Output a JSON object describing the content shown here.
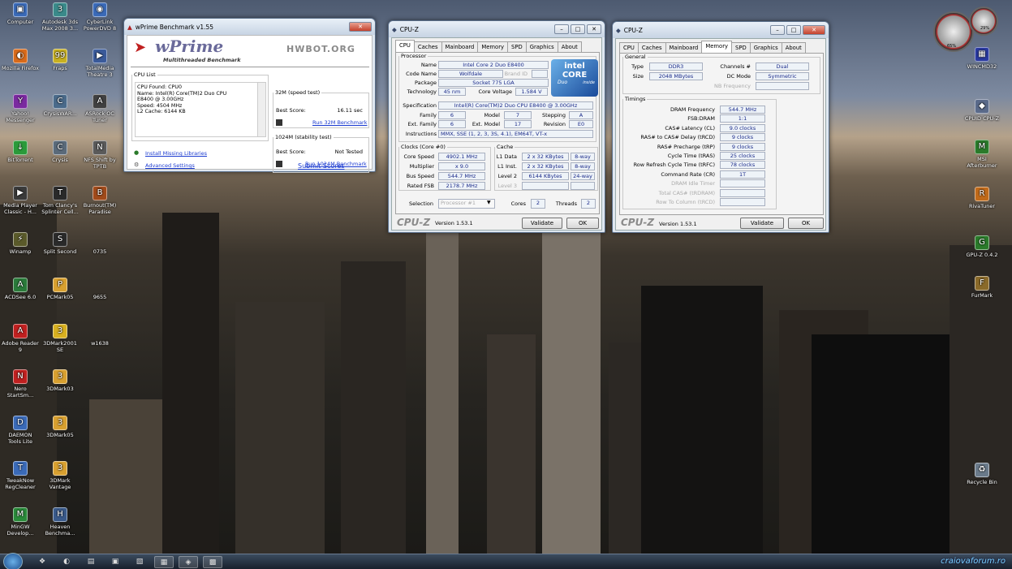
{
  "desktop_icons": [
    {
      "label": "Computer",
      "glyph": "▣",
      "color": "#3a6ab8"
    },
    {
      "label": "Autodesk 3ds Max 2008 3...",
      "glyph": "3",
      "color": "#3a8a8a"
    },
    {
      "label": "CyberLink PowerDVD 8",
      "glyph": "◉",
      "color": "#3a6ab8"
    },
    {
      "label": "Mozilla Firefox",
      "glyph": "◐",
      "color": "#d86a1a"
    },
    {
      "label": "Fraps",
      "glyph": "99",
      "color": "#c8b020"
    },
    {
      "label": "TotalMedia Theatre 3",
      "glyph": "▶",
      "color": "#3a5a9a"
    },
    {
      "label": "Yahoo! Messenger",
      "glyph": "Y",
      "color": "#7a2aa0"
    },
    {
      "label": "CrysisWAR...",
      "glyph": "C",
      "color": "#4a6a8a"
    },
    {
      "label": "ASRock OC Tuner",
      "glyph": "A",
      "color": "#404040"
    },
    {
      "label": "BitTorrent",
      "glyph": "↓",
      "color": "#2a9a3a"
    },
    {
      "label": "Crysis",
      "glyph": "C",
      "color": "#5a6a7a"
    },
    {
      "label": "NFS Shift by TPTB",
      "glyph": "N",
      "color": "#5a5a5a"
    },
    {
      "label": "Media Player Classic - H...",
      "glyph": "▶",
      "color": "#3a3a3a"
    },
    {
      "label": "Tom Clancy's Splinter Cell...",
      "glyph": "T",
      "color": "#2a2a2a"
    },
    {
      "label": "Burnout(TM) Paradise",
      "glyph": "B",
      "color": "#a04a1a"
    },
    {
      "label": "Winamp",
      "glyph": "⚡",
      "color": "#5a5a2a"
    },
    {
      "label": "Split Second",
      "glyph": "S",
      "color": "#2a2a2a"
    },
    {
      "label": "0735",
      "glyph": "",
      "color": "transparent"
    },
    {
      "label": "ACDSee 6.0",
      "glyph": "A",
      "color": "#2a7a3a"
    },
    {
      "label": "PCMark05",
      "glyph": "P",
      "color": "#d8a030"
    },
    {
      "label": "9655",
      "glyph": "",
      "color": "transparent"
    },
    {
      "label": "Adobe Reader 9",
      "glyph": "A",
      "color": "#c02020"
    },
    {
      "label": "3DMark2001 SE",
      "glyph": "3",
      "color": "#d8b020"
    },
    {
      "label": "w1638",
      "glyph": "",
      "color": "transparent"
    },
    {
      "label": "Nero StartSm...",
      "glyph": "N",
      "color": "#c02020"
    },
    {
      "label": "3DMark03",
      "glyph": "3",
      "color": "#d8a030"
    },
    {
      "label": "",
      "glyph": "",
      "color": "transparent"
    },
    {
      "label": "DAEMON Tools Lite",
      "glyph": "D",
      "color": "#3a6ab8"
    },
    {
      "label": "3DMark05",
      "glyph": "3",
      "color": "#d8a030"
    },
    {
      "label": "",
      "glyph": "",
      "color": "transparent"
    },
    {
      "label": "TweakNow RegCleaner",
      "glyph": "T",
      "color": "#3a6ab8"
    },
    {
      "label": "3DMark Vantage",
      "glyph": "3",
      "color": "#d8a030"
    },
    {
      "label": "",
      "glyph": "",
      "color": "transparent"
    },
    {
      "label": "MinGW Develop...",
      "glyph": "M",
      "color": "#2a8a3a"
    },
    {
      "label": "Heaven Benchma...",
      "glyph": "H",
      "color": "#3a5a8a"
    }
  ],
  "right_icons": [
    {
      "label": "WINCMD32",
      "glyph": "▦",
      "color": "#2a3aa0"
    },
    {
      "label": "CPUID CPU-Z",
      "glyph": "◆",
      "color": "#5a6a8a"
    },
    {
      "label": "MSI Afterburner",
      "glyph": "M",
      "color": "#2a7a2a"
    },
    {
      "label": "RivaTuner",
      "glyph": "R",
      "color": "#c06a1a"
    },
    {
      "label": "GPU-Z 0.4.2",
      "glyph": "G",
      "color": "#2a7a2a"
    },
    {
      "label": "FurMark",
      "glyph": "F",
      "color": "#8a6a2a"
    },
    {
      "label": "Recycle Bin",
      "glyph": "♻",
      "color": "#6a7a8a"
    }
  ],
  "gadget": {
    "left": "65%",
    "right": "29%"
  },
  "wprime": {
    "title": "wPrime Benchmark v1.55",
    "logo": "wPrime",
    "subtitle": "Multithreaded Benchmark",
    "hwbot": "HWBOT.ORG",
    "cpu_list_label": "CPU List",
    "cpu_list_lines": [
      "CPU Found: CPU0",
      "Name:   Intel(R) Core(TM)2 Duo CPU",
      "E8400  @ 3.00GHz",
      "Speed:   4504 MHz",
      "L2 Cache: 6144 KB"
    ],
    "test32_label": "32M (speed test)",
    "best_label": "Best Score:",
    "score32": "16.11 sec",
    "run32": "Run 32M Benchmark",
    "test1024_label": "1024M (stability test)",
    "score1024": "Not Tested",
    "run1024": "Run 1024M Benchmark",
    "install": "Install Missing Libraries",
    "advanced": "Advanced Settings",
    "submit": "Submit Scores"
  },
  "cpuz1": {
    "title": "CPU-Z",
    "tabs": [
      "CPU",
      "Caches",
      "Mainboard",
      "Memory",
      "SPD",
      "Graphics",
      "About"
    ],
    "processor_label": "Processor",
    "name_l": "Name",
    "name": "Intel Core 2 Duo E8400",
    "code_l": "Code Name",
    "code": "Wolfdale",
    "brand_l": "Brand ID",
    "pkg_l": "Package",
    "pkg": "Socket 775 LGA",
    "tech_l": "Technology",
    "tech": "45 nm",
    "volt_l": "Core Voltage",
    "volt": "1.584 V",
    "spec_l": "Specification",
    "spec": "Intel(R) Core(TM)2 Duo CPU     E8400  @ 3.00GHz",
    "fam_l": "Family",
    "fam": "6",
    "model_l": "Model",
    "model": "7",
    "step_l": "Stepping",
    "step": "A",
    "efam_l": "Ext. Family",
    "efam": "6",
    "emodel_l": "Ext. Model",
    "emodel": "17",
    "rev_l": "Revision",
    "rev": "E0",
    "instr_l": "Instructions",
    "instr": "MMX, SSE (1, 2, 3, 3S, 4.1), EM64T, VT-x",
    "clocks_label": "Clocks (Core #0)",
    "cs_l": "Core Speed",
    "cs": "4902.1 MHz",
    "mul_l": "Multiplier",
    "mul": "x 9.0",
    "bus_l": "Bus Speed",
    "bus": "544.7 MHz",
    "fsb_l": "Rated FSB",
    "fsb": "2178.7 MHz",
    "cache_label": "Cache",
    "l1d_l": "L1 Data",
    "l1d": "2 x 32 KBytes",
    "l1d_w": "8-way",
    "l1i_l": "L1 Inst.",
    "l1i": "2 x 32 KBytes",
    "l1i_w": "8-way",
    "l2_l": "Level 2",
    "l2": "6144 KBytes",
    "l2_w": "24-way",
    "l3_l": "Level 3",
    "sel_l": "Selection",
    "sel": "Processor #1",
    "cores_l": "Cores",
    "cores": "2",
    "threads_l": "Threads",
    "threads": "2",
    "brand": "CPU-Z",
    "version": "Version 1.53.1",
    "validate": "Validate",
    "ok": "OK",
    "intel_badge": "intel",
    "core_badge": "CORE",
    "duo_badge": "Duo",
    "inside_badge": "inside"
  },
  "cpuz2": {
    "title": "CPU-Z",
    "general_label": "General",
    "type_l": "Type",
    "type": "DDR3",
    "ch_l": "Channels #",
    "ch": "Dual",
    "size_l": "Size",
    "size": "2048 MBytes",
    "dc_l": "DC Mode",
    "dc": "Symmetric",
    "nb_l": "NB Frequency",
    "timings_label": "Timings",
    "timings": [
      {
        "label": "DRAM Frequency",
        "value": "544.7 MHz"
      },
      {
        "label": "FSB:DRAM",
        "value": "1:1"
      },
      {
        "label": "CAS# Latency (CL)",
        "value": "9.0 clocks"
      },
      {
        "label": "RAS# to CAS# Delay (tRCD)",
        "value": "9 clocks"
      },
      {
        "label": "RAS# Precharge (tRP)",
        "value": "9 clocks"
      },
      {
        "label": "Cycle Time (tRAS)",
        "value": "25 clocks"
      },
      {
        "label": "Row Refresh Cycle Time (tRFC)",
        "value": "78 clocks"
      },
      {
        "label": "Command Rate (CR)",
        "value": "1T"
      },
      {
        "label": "DRAM Idle Timer",
        "value": ""
      },
      {
        "label": "Total CAS# (tRDRAM)",
        "value": ""
      },
      {
        "label": "Row To Column (tRCD)",
        "value": ""
      }
    ],
    "version": "Version 1.53.1",
    "validate": "Validate",
    "ok": "OK",
    "brand": "CPU-Z"
  },
  "watermark": "craiovaforum.ro",
  "taskbar": [
    "❖",
    "◐",
    "▤",
    "▣",
    "▧",
    "▦",
    "◈",
    "▩"
  ]
}
